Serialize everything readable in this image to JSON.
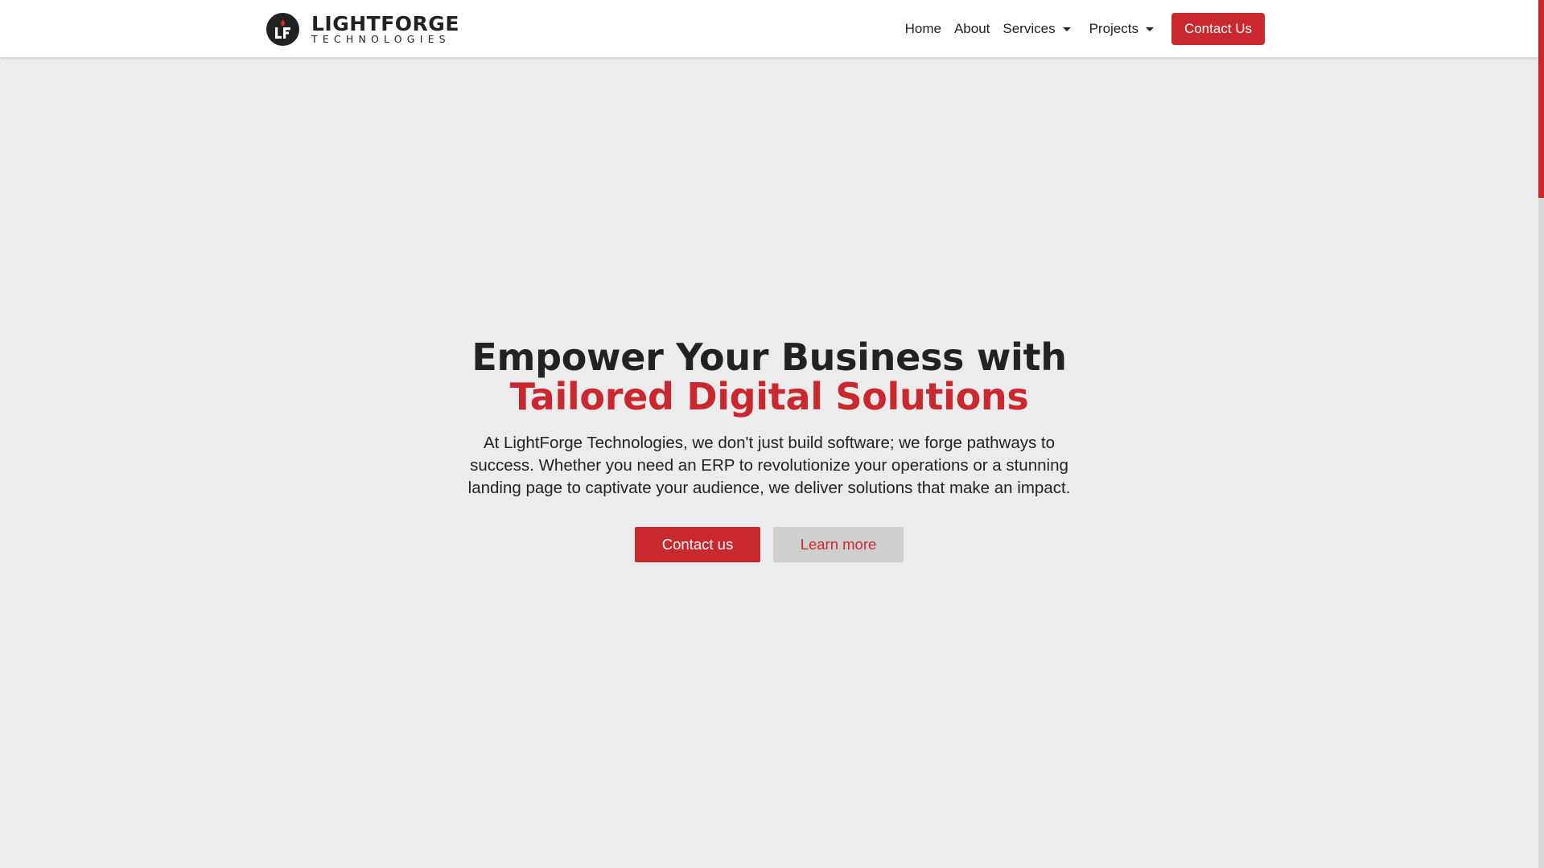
{
  "brand": {
    "name": "LIGHTFORGE",
    "tagline": "TECHNOLOGIES",
    "logo_icon": "lightforge-flame-logo-icon",
    "accent_color": "#c8282e",
    "dark_color": "#222222"
  },
  "nav": {
    "items": [
      {
        "label": "Home"
      },
      {
        "label": "About"
      },
      {
        "label": "Services",
        "icon": "caret-down-icon"
      },
      {
        "label": "Projects",
        "icon": "caret-down-icon"
      }
    ],
    "cta_label": "Contact Us"
  },
  "hero": {
    "title_line1": "Empower Your Business with",
    "title_line2": "Tailored Digital Solutions",
    "description": "At LightForge Technologies, we don't just build software; we forge pathways to success. Whether you need an ERP to revolutionize your operations or a stunning landing page to captivate your audience, we deliver solutions that make an impact.",
    "primary_label": "Contact us",
    "secondary_label": "Learn more"
  },
  "colors": {
    "background": "#ececec",
    "header_bg": "#ffffff",
    "secondary_button_bg": "#cfcfcf"
  }
}
